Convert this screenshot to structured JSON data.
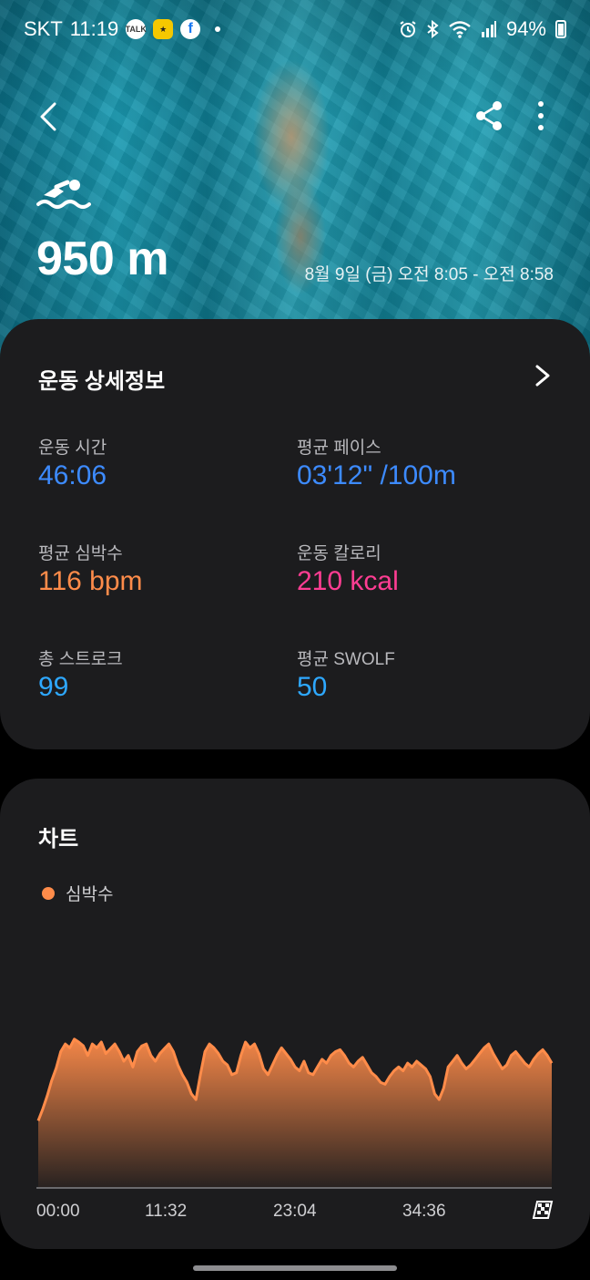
{
  "status_bar": {
    "carrier": "SKT",
    "time": "11:19",
    "battery": "94%",
    "notifications": [
      "talk-icon",
      "kakao-icon",
      "facebook-icon"
    ],
    "system_icons": [
      "alarm-icon",
      "bluetooth-icon",
      "wifi-icon",
      "signal-icon",
      "battery-icon"
    ]
  },
  "header": {
    "workout_icon": "swimming-icon",
    "distance": "950 m",
    "date_range": "8월 9일 (금) 오전 8:05 - 오전 8:58"
  },
  "details": {
    "title": "운동 상세정보",
    "metrics": [
      {
        "label": "운동 시간",
        "value": "46:06",
        "color": "#3d8bff"
      },
      {
        "label": "평균 페이스",
        "value": "03'12\" /100m",
        "color": "#3d8bff"
      },
      {
        "label": "평균 심박수",
        "value": "116 bpm",
        "color": "#ff8c4a"
      },
      {
        "label": "운동 칼로리",
        "value": "210 kcal",
        "color": "#ff3d93"
      },
      {
        "label": "총 스트로크",
        "value": "99",
        "color": "#2ea8ff"
      },
      {
        "label": "평균 SWOLF",
        "value": "50",
        "color": "#2ea8ff"
      }
    ]
  },
  "chart_section": {
    "title": "차트",
    "legend": "심박수"
  },
  "chart_data": {
    "type": "area",
    "x_tick_labels": [
      "00:00",
      "11:32",
      "23:04",
      "34:36"
    ],
    "x_duration_seconds": 2766,
    "series": [
      {
        "name": "심박수",
        "color": "#ff8c4a",
        "values": [
          70,
          82,
          96,
          112,
          125,
          142,
          150,
          146,
          155,
          152,
          148,
          138,
          150,
          146,
          152,
          140,
          145,
          150,
          142,
          132,
          138,
          126,
          142,
          148,
          150,
          138,
          132,
          140,
          145,
          150,
          142,
          128,
          118,
          110,
          98,
          92,
          118,
          142,
          150,
          146,
          140,
          132,
          128,
          118,
          120,
          138,
          152,
          146,
          150,
          140,
          124,
          118,
          128,
          138,
          146,
          140,
          134,
          126,
          122,
          132,
          120,
          118,
          126,
          134,
          130,
          138,
          142,
          144,
          138,
          130,
          126,
          132,
          136,
          128,
          120,
          116,
          110,
          108,
          116,
          122,
          126,
          122,
          130,
          126,
          132,
          128,
          124,
          116,
          98,
          92,
          104,
          126,
          132,
          138,
          130,
          124,
          128,
          134,
          140,
          146,
          150,
          140,
          132,
          124,
          128,
          138,
          142,
          136,
          130,
          126,
          134,
          140,
          144,
          138,
          130
        ]
      }
    ],
    "ylim": [
      0,
      170
    ],
    "grid": false
  },
  "colors": {
    "card_bg": "#1c1c1e",
    "accent_blue": "#3d8bff",
    "accent_orange": "#ff8c4a",
    "accent_pink": "#ff3d93"
  }
}
